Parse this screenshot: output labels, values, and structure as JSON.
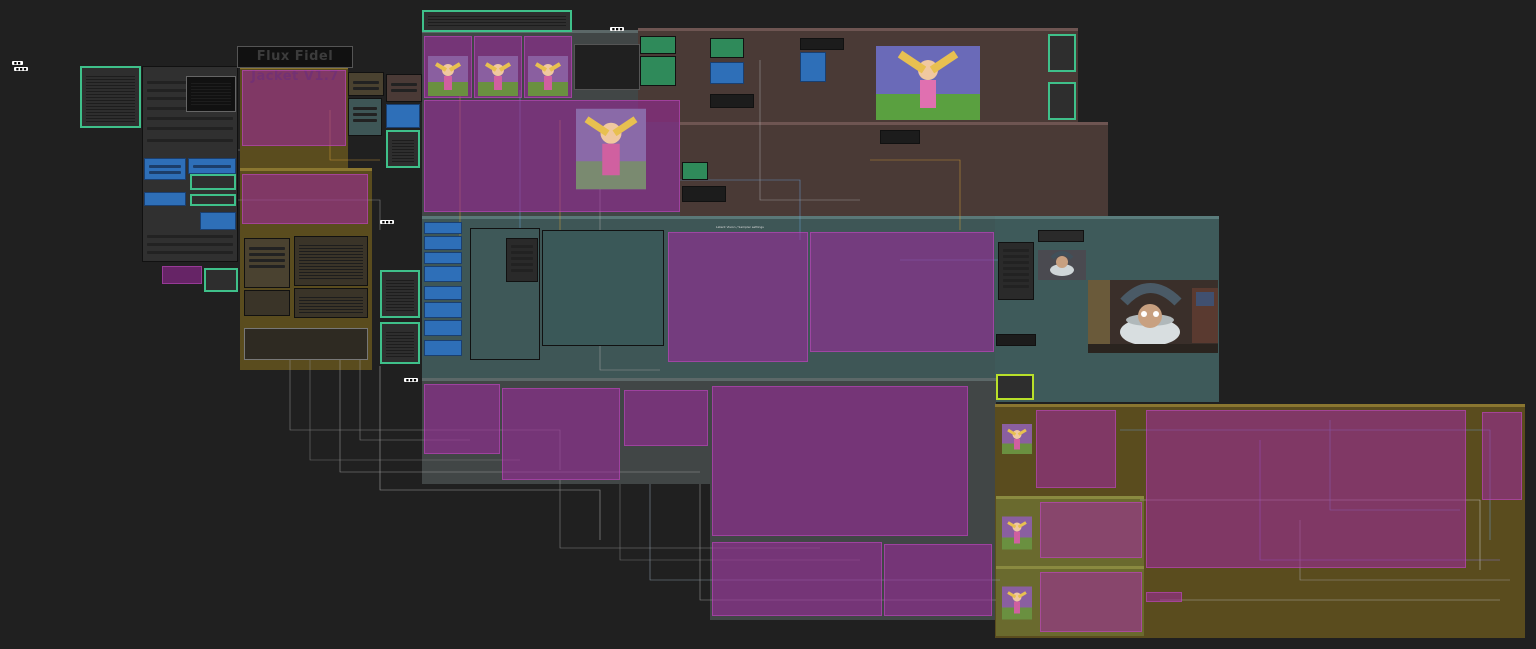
{
  "app": {
    "banner_title": "Flux Fidel Jacket V1.7",
    "center_label": "Latent Vision / Sampler settings"
  },
  "colors": {
    "canvas": "#202020",
    "group_brown": "#4a3a2c",
    "group_teal": "#3e5a5a",
    "group_olive": "#5a4c1e",
    "group_slate": "#414646",
    "node_green_outline": "#3fc08a",
    "node_blue": "#2e6fb8",
    "bypass_magenta": "#a028a0",
    "highlight_yellow": "#b8e02a"
  },
  "floating_labels": {
    "left_top_a": "■ ■",
    "left_top_b": "■ ■ ■",
    "top_note": "■ ■ ■"
  },
  "icons": {
    "preview_character": "cartoon-girl-preview-icon",
    "preview_cup": "teacup-creature-preview-icon"
  }
}
